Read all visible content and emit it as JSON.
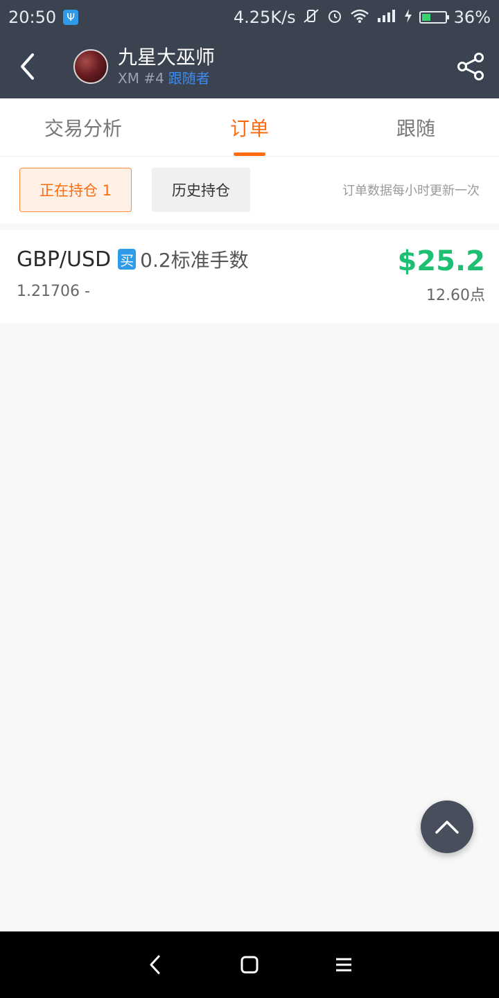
{
  "status_bar": {
    "time": "20:50",
    "usb_icon": "usb-icon",
    "net_speed": "4.25K/s",
    "battery_percent": "36%",
    "battery_level": 0.36
  },
  "header": {
    "title": "九星大巫师",
    "broker": "XM #4",
    "follow_label": "跟随者",
    "back_icon": "chevron-left-icon",
    "share_icon": "share-icon"
  },
  "tabs": [
    {
      "label": "交易分析",
      "active": false
    },
    {
      "label": "订单",
      "active": true
    },
    {
      "label": "跟随",
      "active": false
    }
  ],
  "filters": {
    "open_positions": "正在持仓 1",
    "history_positions": "历史持仓",
    "note": "订单数据每小时更新一次"
  },
  "orders": [
    {
      "pair": "GBP/USD",
      "side": "买",
      "lots": "0.2标准手数",
      "price": "1.21706 -",
      "profit": "$25.2",
      "points": "12.60点"
    }
  ],
  "colors": {
    "accent": "#ff6a0f",
    "profit": "#1dbf73",
    "header_bg": "#3b4350",
    "link": "#3d8bef"
  }
}
